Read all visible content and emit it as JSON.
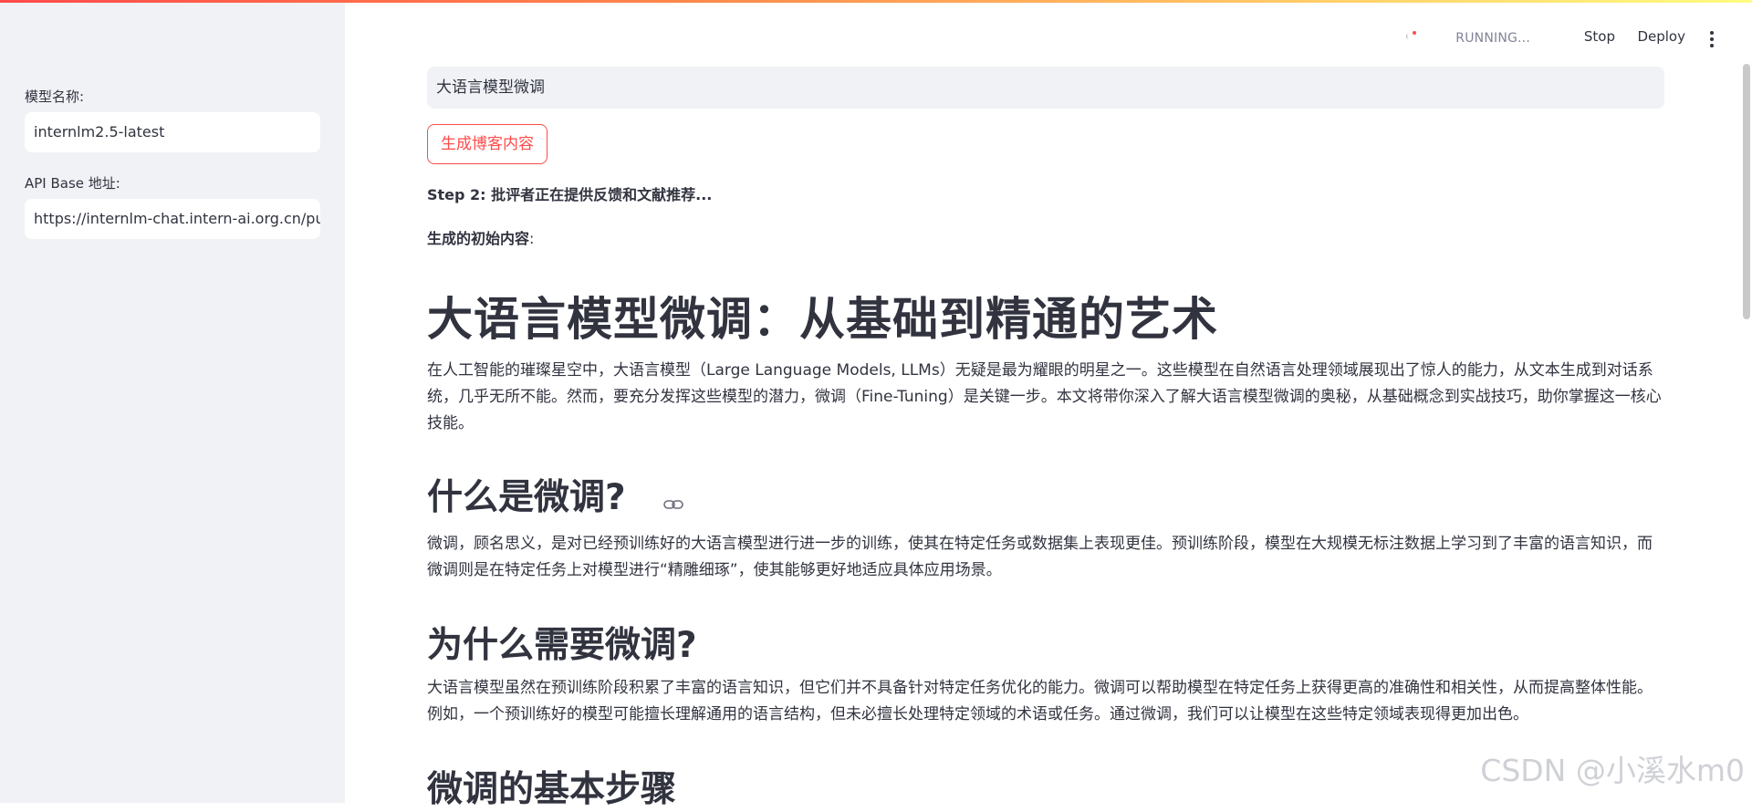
{
  "sidebar": {
    "model_name_label": "模型名称:",
    "model_name_value": "internlm2.5-latest",
    "api_base_label": "API Base 地址:",
    "api_base_value": "https://internlm-chat.intern-ai.org.cn/pu"
  },
  "header": {
    "status_text": "RUNNING...",
    "stop_label": "Stop",
    "deploy_label": "Deploy"
  },
  "main": {
    "topic_value": "大语言模型微调",
    "generate_button_label": "生成博客内容",
    "step_text": "Step 2: 批评者正在提供反馈和文献推荐...",
    "initial_label": "生成的初始内容",
    "initial_colon": ":"
  },
  "article": {
    "title": "大语言模型微调：从基础到精通的艺术",
    "intro": "在人工智能的璀璨星空中，大语言模型（Large Language Models, LLMs）无疑是最为耀眼的明星之一。这些模型在自然语言处理领域展现出了惊人的能力，从文本生成到对话系统，几乎无所不能。然而，要充分发挥这些模型的潜力，微调（Fine-Tuning）是关键一步。本文将带你深入了解大语言模型微调的奥秘，从基础概念到实战技巧，助你掌握这一核心技能。",
    "section1_title": "什么是微调?",
    "section1_text": "微调，顾名思义，是对已经预训练好的大语言模型进行进一步的训练，使其在特定任务或数据集上表现更佳。预训练阶段，模型在大规模无标注数据上学习到了丰富的语言知识，而微调则是在特定任务上对模型进行“精雕细琢”，使其能够更好地适应具体应用场景。",
    "section2_title": "为什么需要微调?",
    "section2_text": "大语言模型虽然在预训练阶段积累了丰富的语言知识，但它们并不具备针对特定任务优化的能力。微调可以帮助模型在特定任务上获得更高的准确性和相关性，从而提高整体性能。例如，一个预训练好的模型可能擅长理解通用的语言结构，但未必擅长处理特定领域的术语或任务。通过微调，我们可以让模型在这些特定领域表现得更加出色。",
    "section3_title": "微调的基本步骤"
  },
  "watermark": "CSDN @小溪水m0",
  "colors": {
    "accent": "#ff4b4b",
    "sidebar_bg": "#f0f2f6",
    "text": "#31333f"
  },
  "icons": {
    "section_link": "link-icon",
    "menu": "kebab-menu-icon"
  }
}
